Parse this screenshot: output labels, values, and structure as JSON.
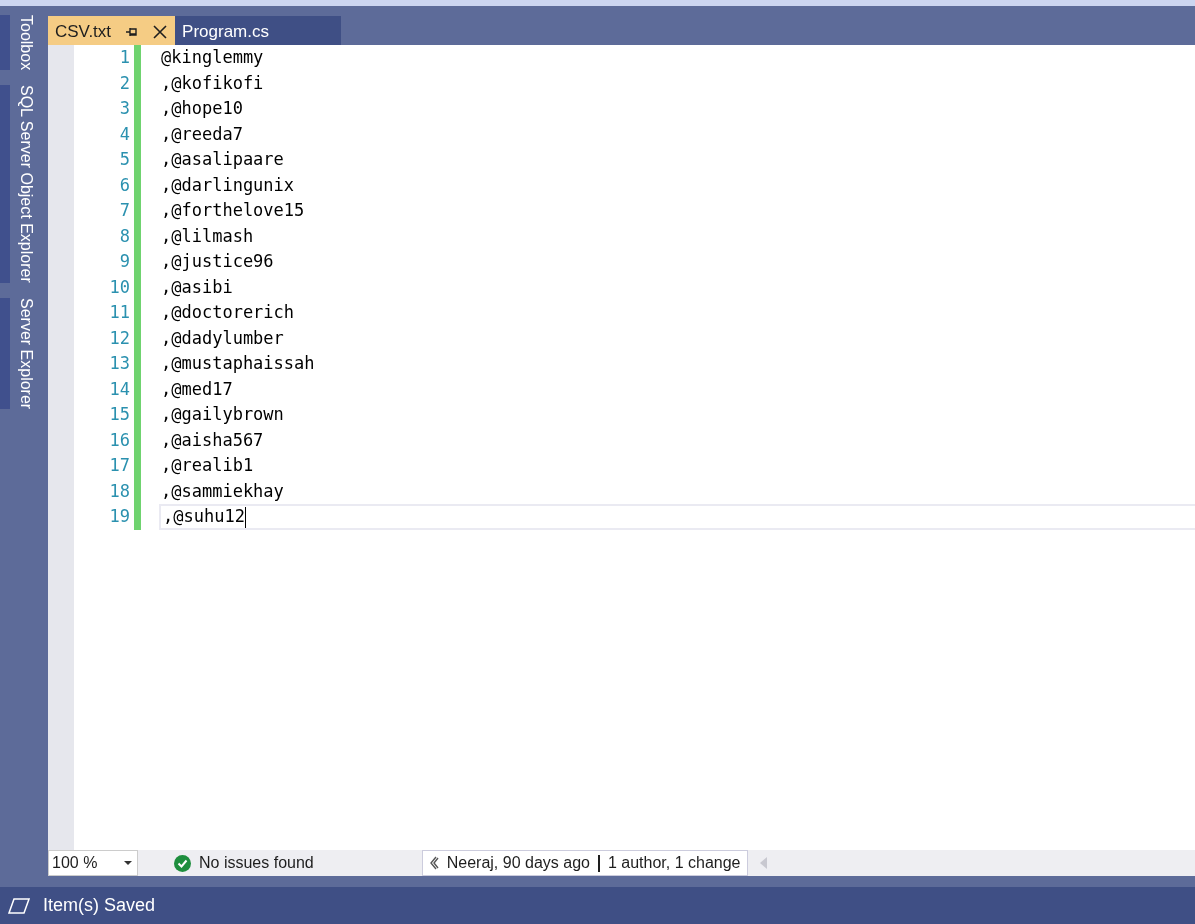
{
  "side_tabs": [
    {
      "label": "Toolbox"
    },
    {
      "label": "SQL Server Object Explorer"
    },
    {
      "label": "Server Explorer"
    }
  ],
  "tabs": [
    {
      "label": "CSV.txt",
      "selected": true
    },
    {
      "label": "Program.cs",
      "selected": false
    }
  ],
  "editor": {
    "lines": [
      {
        "number": "1",
        "text": "@kinglemmy",
        "current": false
      },
      {
        "number": "2",
        "text": ",@kofikofi",
        "current": false
      },
      {
        "number": "3",
        "text": ",@hope10",
        "current": false
      },
      {
        "number": "4",
        "text": ",@reeda7",
        "current": false
      },
      {
        "number": "5",
        "text": ",@asalipaare",
        "current": false
      },
      {
        "number": "6",
        "text": ",@darlingunix",
        "current": false
      },
      {
        "number": "7",
        "text": ",@forthelove15",
        "current": false
      },
      {
        "number": "8",
        "text": ",@lilmash",
        "current": false
      },
      {
        "number": "9",
        "text": ",@justice96",
        "current": false
      },
      {
        "number": "10",
        "text": ",@asibi",
        "current": false
      },
      {
        "number": "11",
        "text": ",@doctorerich",
        "current": false
      },
      {
        "number": "12",
        "text": ",@dadylumber",
        "current": false
      },
      {
        "number": "13",
        "text": ",@mustaphaissah",
        "current": false
      },
      {
        "number": "14",
        "text": ",@med17",
        "current": false
      },
      {
        "number": "15",
        "text": ",@gailybrown",
        "current": false
      },
      {
        "number": "16",
        "text": ",@aisha567",
        "current": false
      },
      {
        "number": "17",
        "text": ",@realib1",
        "current": false
      },
      {
        "number": "18",
        "text": ",@sammiekhay",
        "current": false
      },
      {
        "number": "19",
        "text": ",@suhu12",
        "current": true
      }
    ]
  },
  "editor_footer": {
    "zoom": "100 %",
    "issues": "No issues found",
    "git_author": "Neeraj, 90 days ago",
    "git_changes": "1 author, 1 change"
  },
  "status_bar": {
    "text": "Item(s) Saved"
  }
}
